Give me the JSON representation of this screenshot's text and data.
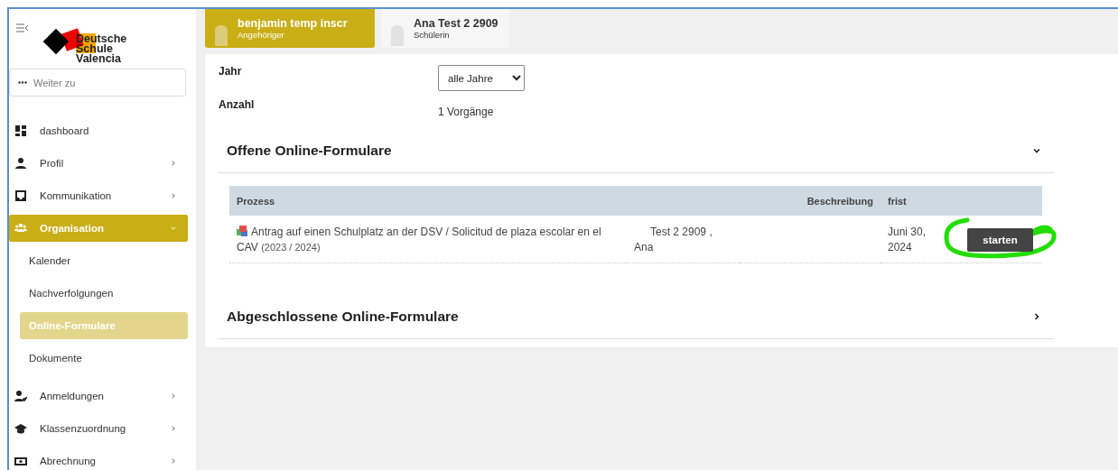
{
  "logo": {
    "text": "Deutsche Schule Valencia"
  },
  "search": {
    "placeholder": "Weiter zu"
  },
  "menu": [
    {
      "label": "dashboard",
      "kind": "grid",
      "selected": false
    },
    {
      "label": "Profil",
      "kind": "user",
      "selected": false,
      "expanded": false
    },
    {
      "label": "Kommunikation",
      "kind": "inbox",
      "selected": false,
      "expanded": false
    },
    {
      "label": "Organisation",
      "kind": "users",
      "selected": true,
      "expanded": true,
      "children": [
        {
          "label": "Kalender",
          "selected": false
        },
        {
          "label": "Nachverfolgungen",
          "selected": false
        },
        {
          "label": "Online-Formulare",
          "selected": true
        },
        {
          "label": "Dokumente",
          "selected": false
        }
      ]
    },
    {
      "label": "Anmeldungen",
      "kind": "user-check",
      "selected": false,
      "expanded": false
    },
    {
      "label": "Klassenzuordnung",
      "kind": "cap",
      "selected": false,
      "expanded": false
    },
    {
      "label": "Abrechnung",
      "kind": "money",
      "selected": false,
      "expanded": false
    }
  ],
  "persons": [
    {
      "name": "benjamin temp inscr",
      "role": "Angehöriger",
      "selected": true
    },
    {
      "name": "Ana Test 2 2909",
      "role": "Schülerin",
      "selected": false
    }
  ],
  "filters": [
    {
      "label": "Jahr",
      "kind": "select",
      "value": "alle Jahre"
    },
    {
      "label": "Anzahl",
      "kind": "text",
      "value": "1 Vorgänge"
    }
  ],
  "sections": [
    {
      "title": "Offene Online-Formulare",
      "expanded": true,
      "table": {
        "columns": {
          "process": "Prozess",
          "description": "Beschreibung",
          "deadline": "frist"
        },
        "rows": [
          {
            "process": "Antrag auf einen Schulplatz an der DSV / Solicitud de plaza escolar en el CAV",
            "period": "(2023 / 2024)",
            "person": "Test 2 2909 , Ana",
            "deadline": "Juni 30, 2024",
            "action": "starten",
            "highlighted": true
          }
        ]
      }
    },
    {
      "title": "Abgeschlossene Online-Formulare",
      "expanded": false
    }
  ]
}
